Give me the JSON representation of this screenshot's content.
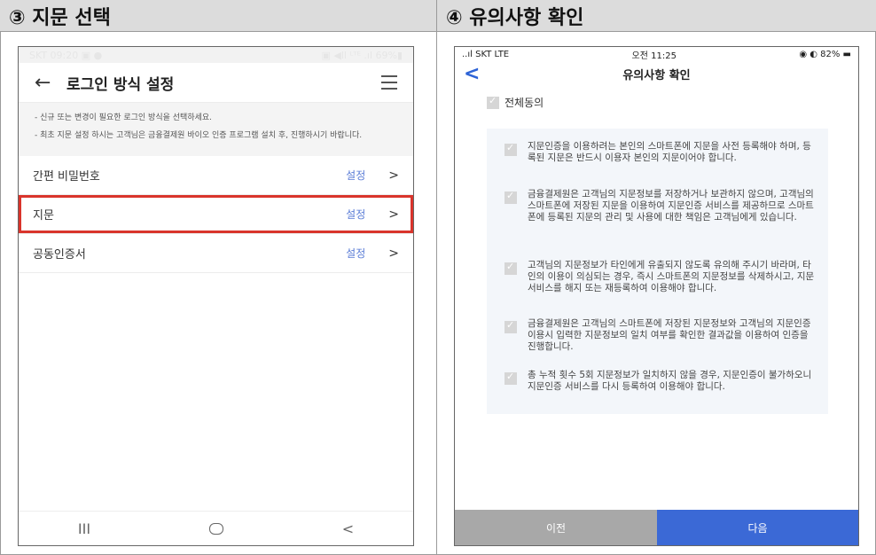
{
  "headers": {
    "left": "③ 지문 선택",
    "right": "④ 유의사항 확인"
  },
  "screen1": {
    "status_left": "SKT 09:20 ▣ ●",
    "status_right": "▣ ◀ll ᴸᵀᴱ .ıl 69%▮",
    "back_glyph": "←",
    "title": "로그인 방식 설정",
    "info1": "- 신규 또는 변경이 필요한 로그인 방식을 선택하세요.",
    "info2": "- 최초 지문 설정 하시는 고객님은 금융결제원 바이오 인증 프로그램 설치 후, 진행하시기 바랍니다.",
    "rows": [
      {
        "label": "간편 비밀번호",
        "action": "설정",
        "arrow": ">"
      },
      {
        "label": "지문",
        "action": "설정",
        "arrow": ">"
      },
      {
        "label": "공동인증서",
        "action": "설정",
        "arrow": ">"
      }
    ],
    "nav": {
      "recent": "III",
      "back": "<"
    }
  },
  "screen2": {
    "status_left": "..ıl SKT LTE",
    "status_time": "오전 11:25",
    "status_right": "◉ ◐ 82% ▬",
    "back_glyph": "<",
    "title": "유의사항 확인",
    "agree_all": "전체동의",
    "terms": [
      "지문인증을 이용하려는 본인의 스마트폰에 지문을 사전 등록해야 하며, 등록된 지문은 반드시 이용자 본인의 지문이어야 합니다.",
      "금융결제원은 고객님의 지문정보를 저장하거나 보관하지 않으며, 고객님의 스마트폰에 저장된 지문을 이용하여 지문인증 서비스를 제공하므로 스마트폰에 등록된 지문의 관리 및 사용에 대한 책임은 고객님에게 있습니다.",
      "고객님의 지문정보가 타인에게 유출되지 않도록 유의해 주시기 바라며, 타인의 이용이 의심되는 경우, 즉시 스마트폰의 지문정보를 삭제하시고, 지문 서비스를 해지 또는 재등록하여 이용해야 합니다.",
      "금융결제원은 고객님의 스마트폰에 저장된 지문정보와 고객님의 지문인증 이용시 입력한 지문정보의 일치 여부를 확인한 결과값을 이용하여 인증을 진행합니다.",
      "총 누적 횟수 5회 지문정보가 일치하지 않을 경우, 지문인증이 불가하오니 지문인증 서비스를 다시 등록하여 이용해야 합니다."
    ],
    "prev": "이전",
    "next": "다음"
  },
  "colors": {
    "accent": "#3b69d6",
    "highlight": "#d9342b",
    "link": "#5a7cd6"
  }
}
